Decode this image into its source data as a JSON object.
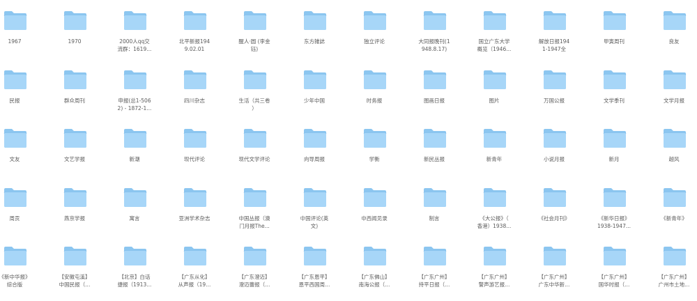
{
  "folder_color": {
    "back": "#8cc6f0",
    "front": "#a7d6f8",
    "edge": "#7bb9e8"
  },
  "folders": [
    "1967",
    "1970",
    "2000人qq交\n流群：1619...",
    "北平新报194\n9.02.01",
    "醒人·圆 (李金\n钰)",
    "东方雑誌",
    "独立评论",
    "大同报晚刊(1\n948.8.17)",
    "国立广东大学\n概览（1946...",
    "解放日报194\n1-1947全",
    "甲寅周刊",
    "良友",
    "民报",
    "群众周刊",
    "申报(总1-506\n2) - 1872-1...",
    "四川杂志",
    "生活（共三卷\n）",
    "少年中国",
    "时务报",
    "图画日报",
    "图片",
    "万国公报",
    "文学季刊",
    "文学月报",
    "文友",
    "文艺学报",
    "新潮",
    "现代评论",
    "现代文学评论",
    "向导周报",
    "学衡",
    "新民丛报",
    "新青年",
    "小说月报",
    "新月",
    "越风",
    "周贡",
    "燕京学报",
    "寓言",
    "亚洲学术杂志",
    "中国丛报（澳\n门月报The...",
    "中国评论(英\n文)",
    "中西闻见录",
    "制言",
    "《大公报》（\n香港）1938...",
    "《社会月刊》",
    "《新华日报》\n1938-1947...",
    "《新青年》",
    "《新中华报》\n综合版",
    "【安徽屯溪】\n中国民报（...",
    "【北京】白话\n捷报（1913...",
    "【广东从化】\n从声报（19...",
    "【广东澄迈】\n澄迈蕾报（...",
    "【广东恩平】\n恩平西国周...",
    "【广东佛山】\n南海公报（...",
    "【广东广州】\n持平日报（...",
    "【广东广州】\n警声游艺报...",
    "【广东广州】\n广东中华新...",
    "【广东广州】\n国华时报（...",
    "【广东广州】\n广州市土地..."
  ]
}
